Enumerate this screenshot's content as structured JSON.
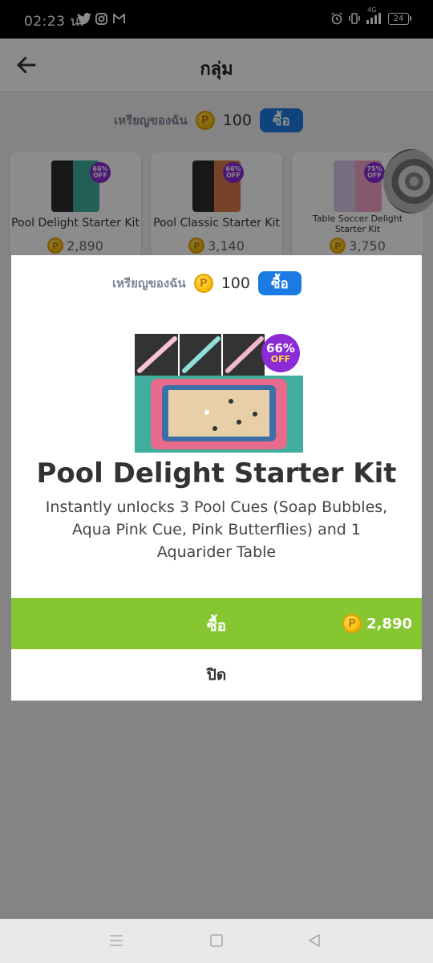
{
  "status_bar": {
    "time": "02:23 น.",
    "battery": "24",
    "signal_label": "4G"
  },
  "header": {
    "title": "กลุ่ม",
    "back_icon": "arrow-left-icon"
  },
  "coins": {
    "label": "เหรียญของฉัน",
    "amount": "100",
    "buy_label": "ซื้อ",
    "coin_symbol": "P"
  },
  "cards": [
    {
      "name": "Pool Delight Starter Kit",
      "price": "2,890",
      "badge_pct": "66%",
      "badge_off": "OFF"
    },
    {
      "name": "Pool Classic Starter Kit",
      "price": "3,140",
      "badge_pct": "66%",
      "badge_off": "OFF"
    },
    {
      "name": "Table Soccer Delight Starter Kit",
      "price": "3,750",
      "badge_pct": "75%",
      "badge_off": "OFF"
    }
  ],
  "dialog": {
    "coins_label": "เหรียญของฉัน",
    "coins_amount": "100",
    "coins_buy": "ซื้อ",
    "badge_pct": "66%",
    "badge_off": "OFF",
    "title": "Pool Delight Starter Kit",
    "description": "Instantly unlocks 3 Pool Cues (Soap Bubbles, Aqua Pink Cue, Pink Butterflies) and 1 Aquarider Table",
    "buy_label": "ซื้อ",
    "price": "2,890",
    "close_label": "ปิด"
  },
  "colors": {
    "buy_green": "#86c630",
    "button_blue": "#1a7be2",
    "badge_purple": "#8a2bd6",
    "coin_gold": "#f5b800"
  }
}
